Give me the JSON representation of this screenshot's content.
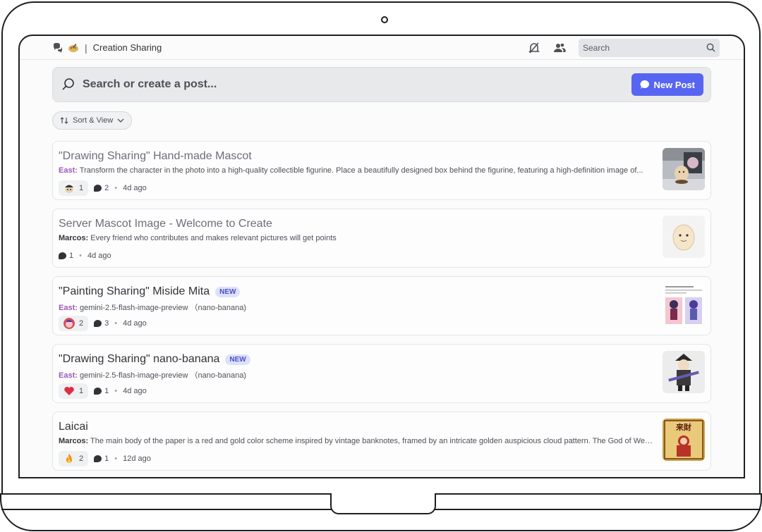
{
  "header": {
    "channel_name": "Creation Sharing",
    "search_placeholder": "Search"
  },
  "post_search": {
    "placeholder": "Search or create a post...",
    "new_post_label": "New Post"
  },
  "sort_label": "Sort & View",
  "new_badge": "NEW",
  "posts": [
    {
      "title": "\"Drawing Sharing\" Hand-made Mascot",
      "author": "East:",
      "preview": "Transform the character in the photo into a high-quality collectible figurine. Place a beautifully designed box behind the figurine, featuring a high-definition image of...",
      "reaction_count": "1",
      "comment_count": "2",
      "time": "4d ago",
      "is_new": false,
      "read": true
    },
    {
      "title": "Server Mascot Image - Welcome to Create",
      "author": "Marcos:",
      "preview": "Every friend who contributes and makes relevant pictures will get points",
      "reaction_count": "",
      "comment_count": "1",
      "time": "4d ago",
      "is_new": false,
      "read": true
    },
    {
      "title": "\"Painting Sharing\" Miside Mita",
      "author": "East:",
      "preview": "gemini-2.5-flash-image-preview （nano-banana)",
      "reaction_count": "2",
      "comment_count": "3",
      "time": "4d ago",
      "is_new": true,
      "read": false
    },
    {
      "title": "\"Drawing Sharing\" nano-banana",
      "author": "East:",
      "preview": "gemini-2.5-flash-image-preview （nano-banana)",
      "reaction_count": "1",
      "comment_count": "1",
      "time": "4d ago",
      "is_new": true,
      "read": false
    },
    {
      "title": "Laicai",
      "author": "Marcos:",
      "preview": "The main body of the paper is a red and gold color scheme inspired by vintage banknotes, framed by an intricate golden auspicious cloud pattern. The God of Wea...",
      "reaction_count": "2",
      "comment_count": "1",
      "time": "12d ago",
      "is_new": false,
      "read": false
    }
  ],
  "thumb_text": "来財",
  "colors": {
    "accent": "#5865f2",
    "author_east": "#9b59b6",
    "badge_bg": "#dee0fc"
  }
}
